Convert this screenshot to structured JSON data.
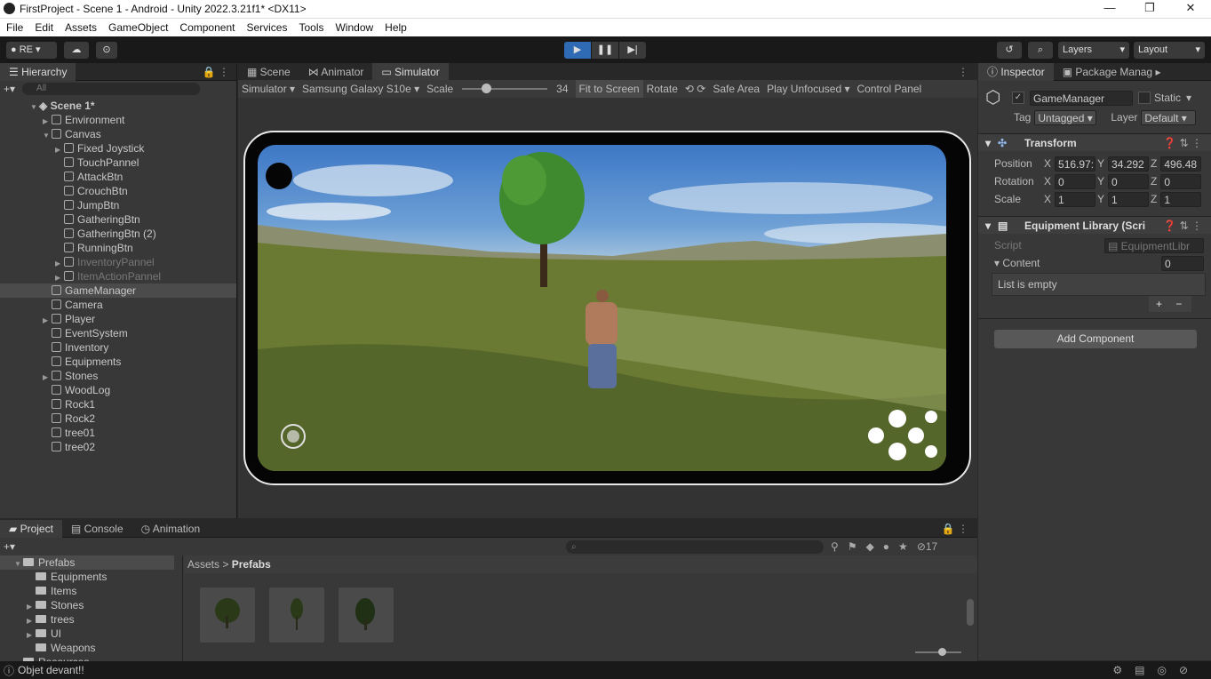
{
  "window": {
    "title": "FirstProject - Scene 1 - Android - Unity 2022.3.21f1* <DX11>",
    "minimize": "—",
    "restore": "❐",
    "close": "✕"
  },
  "menu": [
    "File",
    "Edit",
    "Assets",
    "GameObject",
    "Component",
    "Services",
    "Tools",
    "Window",
    "Help"
  ],
  "toolbar": {
    "account": "RE",
    "layers": "Layers",
    "layout": "Layout"
  },
  "hierarchy": {
    "tab": "Hierarchy",
    "search_placeholder": "All",
    "scene": "Scene 1*",
    "items": [
      {
        "label": "Environment"
      },
      {
        "label": "Canvas"
      },
      {
        "label": "Fixed Joystick"
      },
      {
        "label": "TouchPannel"
      },
      {
        "label": "AttackBtn"
      },
      {
        "label": "CrouchBtn"
      },
      {
        "label": "JumpBtn"
      },
      {
        "label": "GatheringBtn"
      },
      {
        "label": "GatheringBtn (2)"
      },
      {
        "label": "RunningBtn"
      },
      {
        "label": "InventoryPannel"
      },
      {
        "label": "ItemActionPannel"
      },
      {
        "label": "GameManager"
      },
      {
        "label": "Camera"
      },
      {
        "label": "Player"
      },
      {
        "label": "EventSystem"
      },
      {
        "label": "Inventory"
      },
      {
        "label": "Equipments"
      },
      {
        "label": "Stones"
      },
      {
        "label": "WoodLog"
      },
      {
        "label": "Rock1"
      },
      {
        "label": "Rock2"
      },
      {
        "label": "tree01"
      },
      {
        "label": "tree02"
      }
    ]
  },
  "center_tabs": {
    "scene": "Scene",
    "animator": "Animator",
    "simulator": "Simulator"
  },
  "simulator": {
    "mode": "Simulator ▾",
    "device": "Samsung Galaxy S10e ▾",
    "scale_label": "Scale",
    "scale_value": "34",
    "scale_level": 0.28,
    "fit": "Fit to Screen",
    "rotate": "Rotate",
    "safe_area": "Safe Area",
    "play_mode": "Play Unfocused ▾",
    "control_panel": "Control Panel"
  },
  "inspector": {
    "tab": "Inspector",
    "tab2": "Package Manag",
    "object_name": "GameManager",
    "static": "Static",
    "tag_label": "Tag",
    "tag": "Untagged",
    "layer_label": "Layer",
    "layer": "Default",
    "transform": "Transform",
    "position_label": "Position",
    "rotation_label": "Rotation",
    "scale_label": "Scale",
    "position": {
      "x": "516.97:",
      "y": "34.292",
      "z": "496.48"
    },
    "rotation": {
      "x": "0",
      "y": "0",
      "z": "0"
    },
    "scale": {
      "x": "1",
      "y": "1",
      "z": "1"
    },
    "component": "Equipment Library (Scri",
    "script_label": "Script",
    "script": "EquipmentLibr",
    "content_label": "Content",
    "content_count": "0",
    "list_empty": "List is empty",
    "add_component": "Add Component",
    "axis": {
      "x": "X",
      "y": "Y",
      "z": "Z"
    }
  },
  "project": {
    "tabs": {
      "project": "Project",
      "console": "Console",
      "animation": "Animation"
    },
    "tree": [
      "Prefabs",
      "Equipments",
      "Items",
      "Stones",
      "trees",
      "UI",
      "Weapons",
      "Resources"
    ],
    "breadcrumb_root": "Assets",
    "breadcrumb_sep": ">",
    "breadcrumb_current": "Prefabs",
    "hidden_count": "17"
  },
  "status": {
    "message": "Objet devant!!"
  },
  "colors": {
    "accent": "#2f6bb5",
    "selection": "#4b4b4b",
    "panel": "#383838"
  }
}
